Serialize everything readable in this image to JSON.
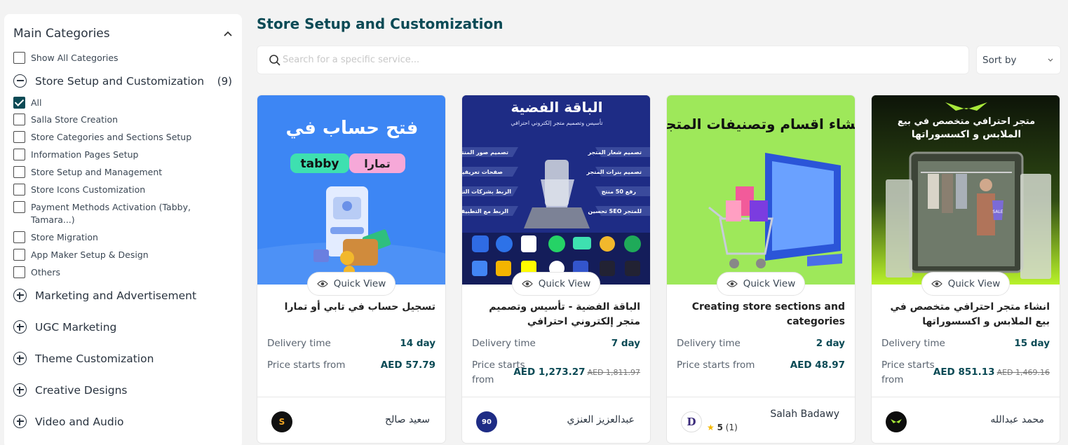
{
  "sidebar": {
    "title": "Main Categories",
    "show_all": "Show All Categories",
    "open_category": {
      "label": "Store Setup and Customization",
      "count": "(9)"
    },
    "subcategories": [
      {
        "label": "All",
        "checked": true
      },
      {
        "label": "Salla Store Creation",
        "checked": false
      },
      {
        "label": "Store Categories and Sections Setup",
        "checked": false
      },
      {
        "label": "Information Pages Setup",
        "checked": false
      },
      {
        "label": "Store Setup and Management",
        "checked": false
      },
      {
        "label": "Store Icons Customization",
        "checked": false
      },
      {
        "label": "Payment Methods Activation (Tabby, Tamara...)",
        "checked": false
      },
      {
        "label": "Store Migration",
        "checked": false
      },
      {
        "label": "App Maker Setup & Design",
        "checked": false
      },
      {
        "label": "Others",
        "checked": false
      }
    ],
    "categories": [
      "Marketing and Advertisement",
      "UGC Marketing",
      "Theme Customization",
      "Creative Designs",
      "Video and Audio"
    ]
  },
  "main": {
    "title": "Store Setup and Customization",
    "search_placeholder": "Search for a specific service...",
    "sort_label": "Sort by"
  },
  "labels": {
    "quick_view": "Quick View",
    "delivery": "Delivery time",
    "price": "Price starts from"
  },
  "cards": [
    {
      "title": "تسجيل حساب في تابي أو تمارا",
      "delivery": "14 day",
      "price": "AED 57.79",
      "old_price": "",
      "seller": "سعيد صالح",
      "avatar_text": "S",
      "rating": "",
      "image": {
        "heading": "فتح حساب في",
        "badge_left": "tabby",
        "badge_right": "تمارا"
      }
    },
    {
      "title": "الباقة الفضية - تأسيس وتصميم متجر إلكتروني احترافي",
      "delivery": "7 day",
      "price": "AED 1,273.27",
      "old_price": "AED 1,811.97",
      "seller": "عبدالعزيز العنزي",
      "avatar_text": "90",
      "rating": "",
      "image": {
        "heading": "الباقة الفضية",
        "subheading": "تأسيس وتصميم متجر إلكتروني احترافي",
        "features_left": [
          "تصميم صور المنتجات",
          "صفحات تعريفية",
          "الربط بشركات التقسيط",
          "الربط مع التطبيقات"
        ],
        "features_right": [
          "تصميم شعار المتجر",
          "تصميم بنرات المتجر",
          "رفع 50 منتج",
          "تحسين SEO للمتجر"
        ]
      }
    },
    {
      "title": "Creating store sections and categories",
      "delivery": "2 day",
      "price": "AED 48.97",
      "old_price": "",
      "seller": "Salah Badawy",
      "avatar_text": "D",
      "rating": "5",
      "rating_count": "(1)",
      "image": {
        "heading": "انشاء اقسام وتصنيفات المتجر"
      }
    },
    {
      "title": "انشاء متجر احترافي متخصص في بيع الملابس و اكسسوراتها",
      "delivery": "15 day",
      "price": "AED 851.13",
      "old_price": "AED 1,469.16",
      "seller": "محمد عبدالله",
      "avatar_text": "",
      "rating": "",
      "image": {
        "heading1": "متجر احترافي متخصص في بيع",
        "heading2": "الملابس و اكسسوراتها",
        "sign": "SALE"
      }
    }
  ]
}
